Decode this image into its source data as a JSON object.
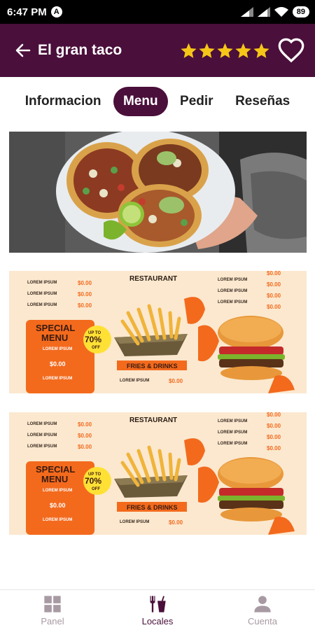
{
  "status": {
    "time": "6:47 PM",
    "a_glyph": "A",
    "battery": "89"
  },
  "app_bar": {
    "title": "El gran taco",
    "rating_stars": 5
  },
  "tabs": [
    {
      "label": "Informacion",
      "active": false
    },
    {
      "label": "Menu",
      "active": true
    },
    {
      "label": "Pedir",
      "active": false
    },
    {
      "label": "Reseñas",
      "active": false
    }
  ],
  "menu_card": {
    "restaurant": "RESTAURANT",
    "special": "SPECIAL",
    "menu": "MENU",
    "up_to": "UP TO",
    "discount": "70%",
    "off": "OFF",
    "lorem": "LOREM IPSUM",
    "price": "$0.00",
    "fries_drinks": "FRIES & DRINKS"
  },
  "bottom_nav": [
    {
      "label": "Panel",
      "icon": "grid-icon",
      "active": false
    },
    {
      "label": "Locales",
      "icon": "fork-cup-icon",
      "active": true
    },
    {
      "label": "Cuenta",
      "icon": "person-icon",
      "active": false
    }
  ],
  "colors": {
    "primary": "#4a0f3a",
    "star": "#f5c518",
    "menu_bg": "#fbe8cf",
    "menu_accent": "#f36a1d"
  }
}
